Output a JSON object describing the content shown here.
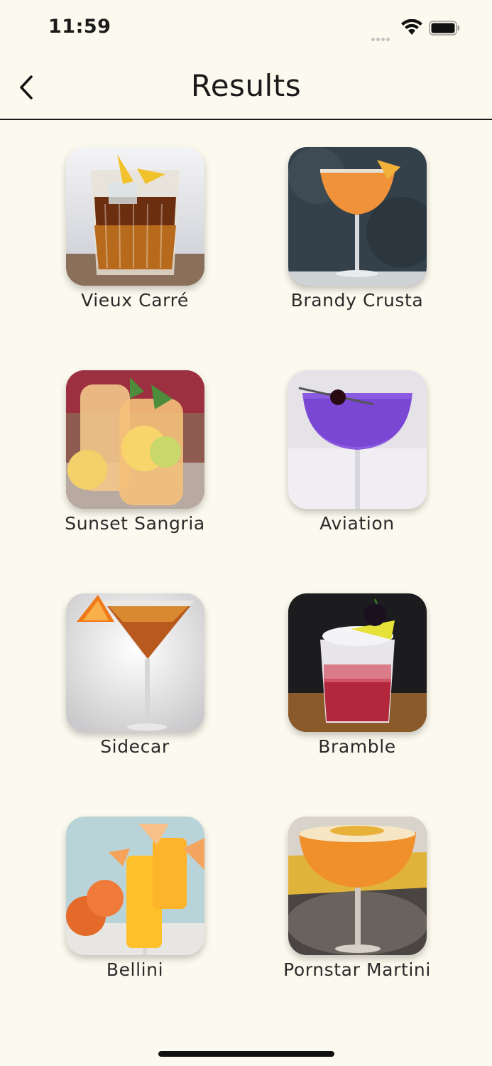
{
  "status_bar": {
    "time": "11:59"
  },
  "nav": {
    "title": "Results"
  },
  "results": [
    {
      "name": "Vieux Carré"
    },
    {
      "name": "Brandy Crusta"
    },
    {
      "name": "Sunset Sangria"
    },
    {
      "name": "Aviation"
    },
    {
      "name": "Sidecar"
    },
    {
      "name": "Bramble"
    },
    {
      "name": "Bellini"
    },
    {
      "name": "Pornstar Martini"
    }
  ]
}
